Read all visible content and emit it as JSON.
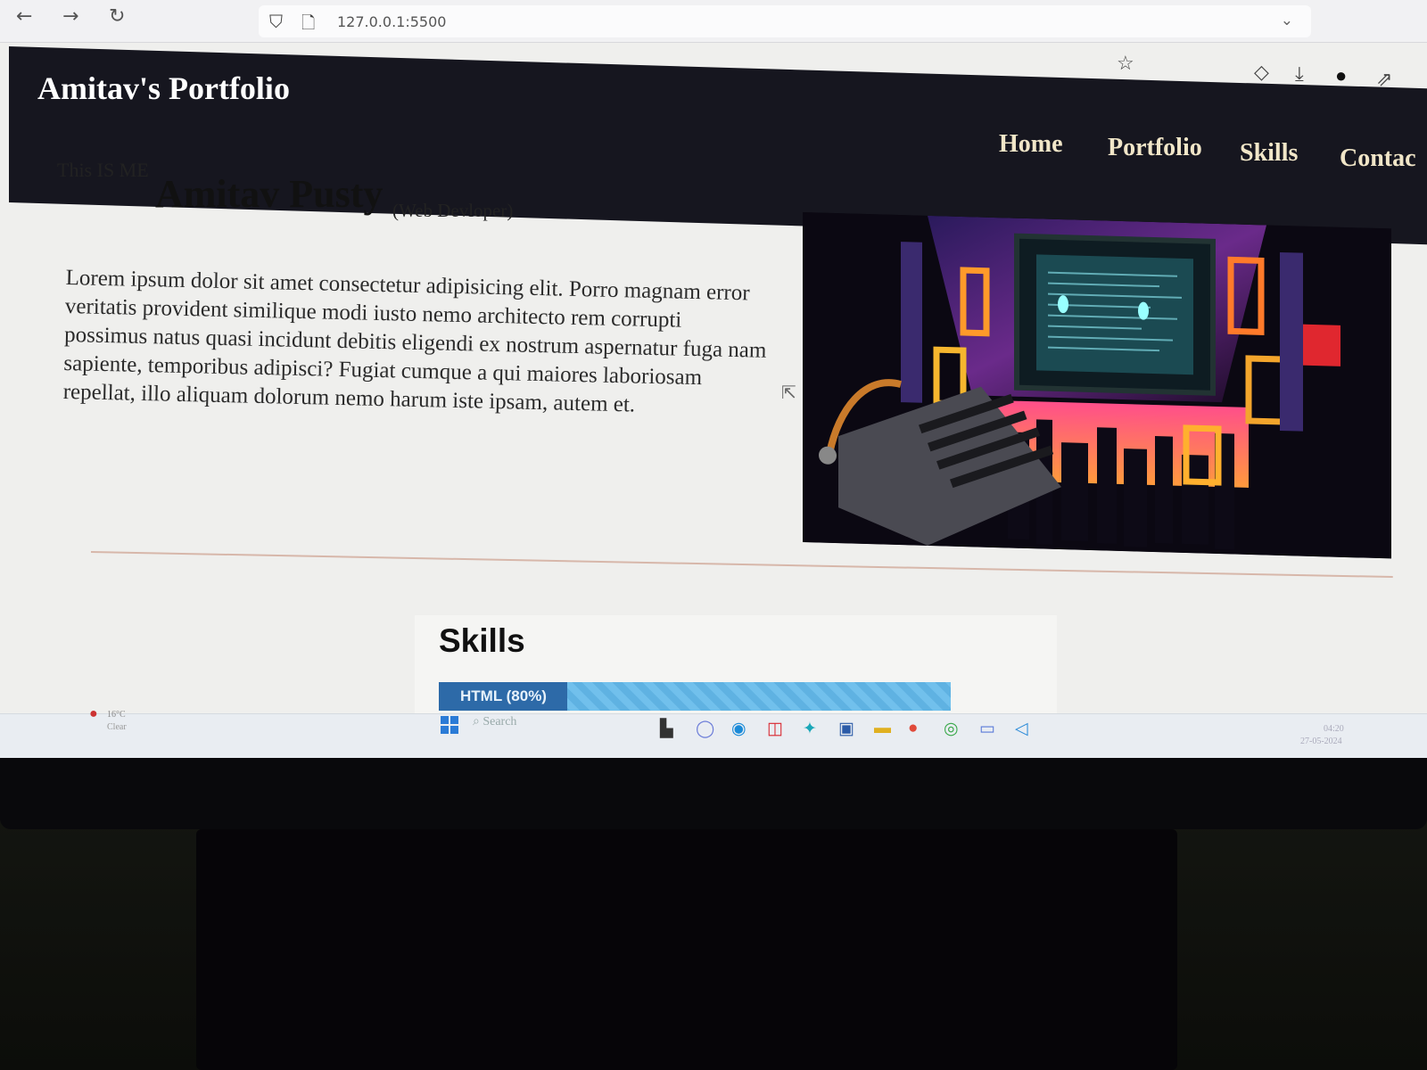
{
  "browser": {
    "back_icon": "arrow-left",
    "forward_icon": "arrow-right",
    "reload_icon": "reload",
    "url": "127.0.0.1:5500"
  },
  "site": {
    "title": "Amitav's Portfolio",
    "nav": [
      "Home",
      "Portfolio",
      "Skills",
      "Contac"
    ]
  },
  "hero": {
    "tagline": "This IS ME",
    "name": "Amitav Pusty",
    "role": "(Web Devloper)",
    "paragraph": "Lorem ipsum dolor sit amet consectetur adipisicing elit. Porro magnam error veritatis provident similique modi iusto nemo architecto rem corrupti possimus natus quasi incidunt debitis eligendi ex nostrum aspernatur fuga nam sapiente, temporibus adipisci? Fugiat cumque a qui maiores laboriosam repellat, illo aliquam dolorum nemo harum iste ipsam, autem et."
  },
  "skills": {
    "title": "Skills",
    "items": [
      {
        "label": "HTML (80%)",
        "percent": 80
      }
    ]
  },
  "taskbar": {
    "search_placeholder": "Search",
    "weather_temp": "16°C",
    "weather_condition": "Clear",
    "time": "04:20",
    "date": "27-05-2024"
  },
  "colors": {
    "header_bg": "#16161f",
    "nav_text": "#f1e6c8",
    "skill_track": "#5fb2e2",
    "skill_fill": "#2d6aa8"
  }
}
